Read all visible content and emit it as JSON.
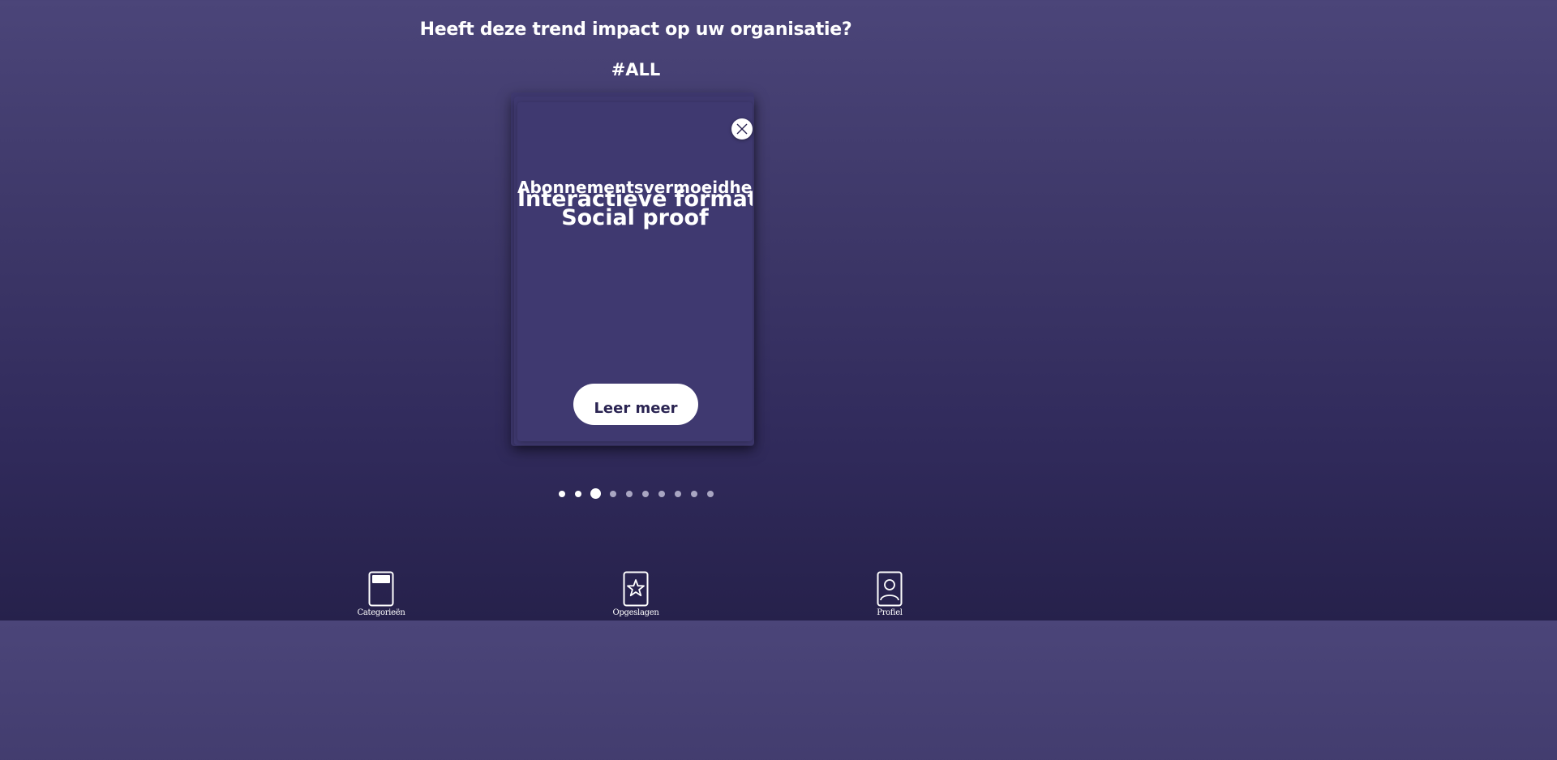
{
  "header": {
    "question": "Heeft deze trend impact op uw organisatie?",
    "category": "#ALL"
  },
  "cards": {
    "titles": [
      "Abonnementsvermoeidhei",
      "Interactieve formats",
      "Social proof"
    ],
    "learn_more_label": "Leer meer",
    "close_icon": "close-icon"
  },
  "pagination": {
    "total": 10,
    "visited": 2,
    "active_index": 2
  },
  "bottom_nav": {
    "items": [
      {
        "label": "Categorieën",
        "icon": "category-card-icon"
      },
      {
        "label": "Opgeslagen",
        "icon": "star-card-icon"
      },
      {
        "label": "Profiel",
        "icon": "profile-card-icon"
      }
    ]
  },
  "colors": {
    "background_top": "#4b4579",
    "background_bottom": "#26214b",
    "card": "#3f3970",
    "button_text": "#2a2452",
    "dot_inactive": "#a9a6c2"
  }
}
